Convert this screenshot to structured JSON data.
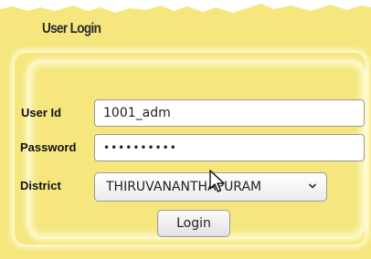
{
  "login_box": {
    "title": "User Login",
    "user_id": {
      "label": "User Id",
      "value": "1001_adm"
    },
    "password": {
      "label": "Password",
      "value": "••••••••••"
    },
    "district": {
      "label": "District",
      "selected": "THIRUVANANTHAPURAM"
    },
    "login_button": "Login"
  },
  "icons": {
    "dropdown": "chevron-down-icon",
    "cursor": "mouse-pointer-icon"
  },
  "colors": {
    "panel_background": "#f5e77e",
    "frame_glow": "#fff8c8"
  }
}
